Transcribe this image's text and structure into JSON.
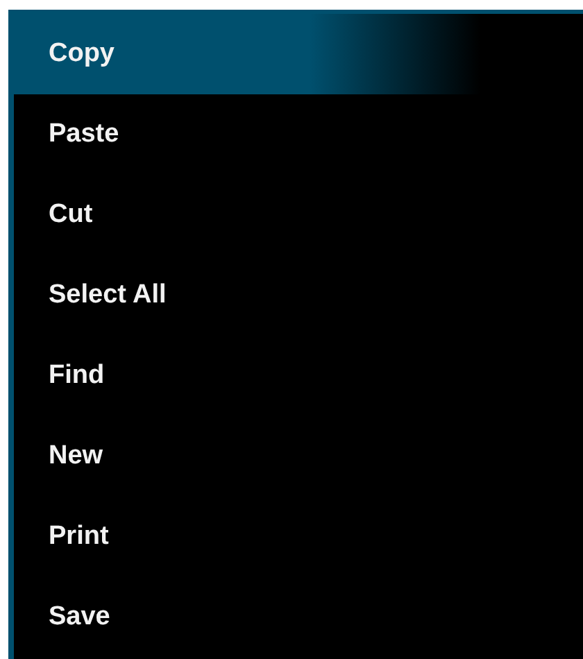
{
  "menu": {
    "items": [
      {
        "label": "Copy",
        "selected": true
      },
      {
        "label": "Paste",
        "selected": false
      },
      {
        "label": "Cut",
        "selected": false
      },
      {
        "label": "Select All",
        "selected": false
      },
      {
        "label": "Find",
        "selected": false
      },
      {
        "label": "New",
        "selected": false
      },
      {
        "label": "Print",
        "selected": false
      },
      {
        "label": "Save",
        "selected": false
      }
    ]
  }
}
